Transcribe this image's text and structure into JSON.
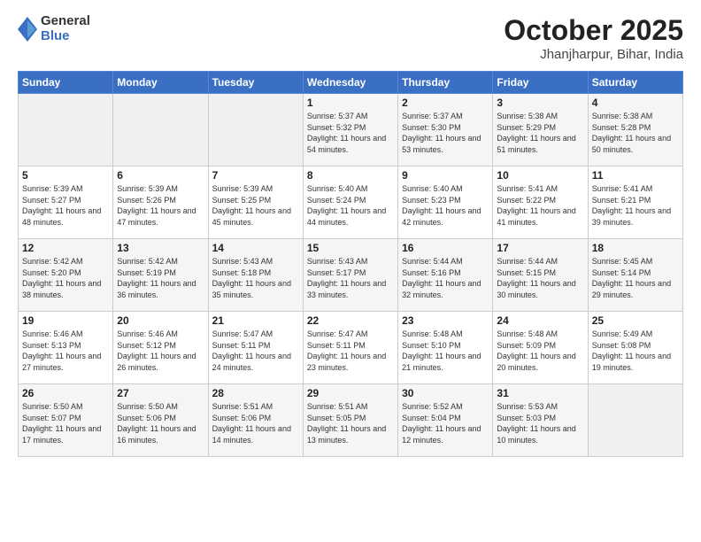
{
  "header": {
    "logo_general": "General",
    "logo_blue": "Blue",
    "title": "October 2025",
    "subtitle": "Jhanjharpur, Bihar, India"
  },
  "weekdays": [
    "Sunday",
    "Monday",
    "Tuesday",
    "Wednesday",
    "Thursday",
    "Friday",
    "Saturday"
  ],
  "weeks": [
    [
      {
        "day": "",
        "info": ""
      },
      {
        "day": "",
        "info": ""
      },
      {
        "day": "",
        "info": ""
      },
      {
        "day": "1",
        "info": "Sunrise: 5:37 AM\nSunset: 5:32 PM\nDaylight: 11 hours\nand 54 minutes."
      },
      {
        "day": "2",
        "info": "Sunrise: 5:37 AM\nSunset: 5:30 PM\nDaylight: 11 hours\nand 53 minutes."
      },
      {
        "day": "3",
        "info": "Sunrise: 5:38 AM\nSunset: 5:29 PM\nDaylight: 11 hours\nand 51 minutes."
      },
      {
        "day": "4",
        "info": "Sunrise: 5:38 AM\nSunset: 5:28 PM\nDaylight: 11 hours\nand 50 minutes."
      }
    ],
    [
      {
        "day": "5",
        "info": "Sunrise: 5:39 AM\nSunset: 5:27 PM\nDaylight: 11 hours\nand 48 minutes."
      },
      {
        "day": "6",
        "info": "Sunrise: 5:39 AM\nSunset: 5:26 PM\nDaylight: 11 hours\nand 47 minutes."
      },
      {
        "day": "7",
        "info": "Sunrise: 5:39 AM\nSunset: 5:25 PM\nDaylight: 11 hours\nand 45 minutes."
      },
      {
        "day": "8",
        "info": "Sunrise: 5:40 AM\nSunset: 5:24 PM\nDaylight: 11 hours\nand 44 minutes."
      },
      {
        "day": "9",
        "info": "Sunrise: 5:40 AM\nSunset: 5:23 PM\nDaylight: 11 hours\nand 42 minutes."
      },
      {
        "day": "10",
        "info": "Sunrise: 5:41 AM\nSunset: 5:22 PM\nDaylight: 11 hours\nand 41 minutes."
      },
      {
        "day": "11",
        "info": "Sunrise: 5:41 AM\nSunset: 5:21 PM\nDaylight: 11 hours\nand 39 minutes."
      }
    ],
    [
      {
        "day": "12",
        "info": "Sunrise: 5:42 AM\nSunset: 5:20 PM\nDaylight: 11 hours\nand 38 minutes."
      },
      {
        "day": "13",
        "info": "Sunrise: 5:42 AM\nSunset: 5:19 PM\nDaylight: 11 hours\nand 36 minutes."
      },
      {
        "day": "14",
        "info": "Sunrise: 5:43 AM\nSunset: 5:18 PM\nDaylight: 11 hours\nand 35 minutes."
      },
      {
        "day": "15",
        "info": "Sunrise: 5:43 AM\nSunset: 5:17 PM\nDaylight: 11 hours\nand 33 minutes."
      },
      {
        "day": "16",
        "info": "Sunrise: 5:44 AM\nSunset: 5:16 PM\nDaylight: 11 hours\nand 32 minutes."
      },
      {
        "day": "17",
        "info": "Sunrise: 5:44 AM\nSunset: 5:15 PM\nDaylight: 11 hours\nand 30 minutes."
      },
      {
        "day": "18",
        "info": "Sunrise: 5:45 AM\nSunset: 5:14 PM\nDaylight: 11 hours\nand 29 minutes."
      }
    ],
    [
      {
        "day": "19",
        "info": "Sunrise: 5:46 AM\nSunset: 5:13 PM\nDaylight: 11 hours\nand 27 minutes."
      },
      {
        "day": "20",
        "info": "Sunrise: 5:46 AM\nSunset: 5:12 PM\nDaylight: 11 hours\nand 26 minutes."
      },
      {
        "day": "21",
        "info": "Sunrise: 5:47 AM\nSunset: 5:11 PM\nDaylight: 11 hours\nand 24 minutes."
      },
      {
        "day": "22",
        "info": "Sunrise: 5:47 AM\nSunset: 5:11 PM\nDaylight: 11 hours\nand 23 minutes."
      },
      {
        "day": "23",
        "info": "Sunrise: 5:48 AM\nSunset: 5:10 PM\nDaylight: 11 hours\nand 21 minutes."
      },
      {
        "day": "24",
        "info": "Sunrise: 5:48 AM\nSunset: 5:09 PM\nDaylight: 11 hours\nand 20 minutes."
      },
      {
        "day": "25",
        "info": "Sunrise: 5:49 AM\nSunset: 5:08 PM\nDaylight: 11 hours\nand 19 minutes."
      }
    ],
    [
      {
        "day": "26",
        "info": "Sunrise: 5:50 AM\nSunset: 5:07 PM\nDaylight: 11 hours\nand 17 minutes."
      },
      {
        "day": "27",
        "info": "Sunrise: 5:50 AM\nSunset: 5:06 PM\nDaylight: 11 hours\nand 16 minutes."
      },
      {
        "day": "28",
        "info": "Sunrise: 5:51 AM\nSunset: 5:06 PM\nDaylight: 11 hours\nand 14 minutes."
      },
      {
        "day": "29",
        "info": "Sunrise: 5:51 AM\nSunset: 5:05 PM\nDaylight: 11 hours\nand 13 minutes."
      },
      {
        "day": "30",
        "info": "Sunrise: 5:52 AM\nSunset: 5:04 PM\nDaylight: 11 hours\nand 12 minutes."
      },
      {
        "day": "31",
        "info": "Sunrise: 5:53 AM\nSunset: 5:03 PM\nDaylight: 11 hours\nand 10 minutes."
      },
      {
        "day": "",
        "info": ""
      }
    ]
  ]
}
